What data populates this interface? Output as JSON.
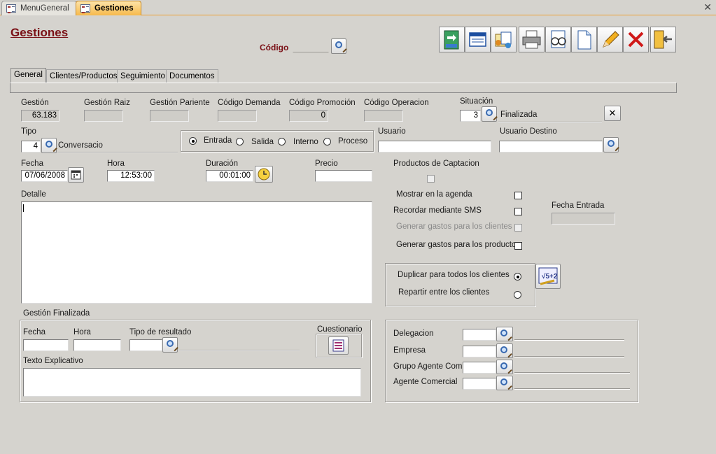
{
  "tabs": {
    "menu_general": "MenuGeneral",
    "gestiones": "Gestiones"
  },
  "header": {
    "title": "Gestiones",
    "codigo_label": "Código",
    "codigo_value": ""
  },
  "toolbar": [
    "door-green-icon",
    "windows-icon",
    "documents-icon",
    "printer-icon",
    "preview-icon",
    "new-doc-icon",
    "pencil-icon",
    "delete-x-icon",
    "exit-door-icon"
  ],
  "page_tabs": [
    "General",
    "Clientes/Productos",
    "Seguimiento",
    "Documentos"
  ],
  "general": {
    "gestion_label": "Gestión",
    "gestion_value": "63.183",
    "gestion_raiz_label": "Gestión Raiz",
    "gestion_raiz_value": "",
    "gestion_pariente_label": "Gestión Pariente",
    "gestion_pariente_value": "",
    "codigo_demanda_label": "Código Demanda",
    "codigo_demanda_value": "",
    "codigo_promocion_label": "Código Promoción",
    "codigo_promocion_value": "0",
    "codigo_operacion_label": "Código Operacion",
    "codigo_operacion_value": "",
    "situacion_label": "Situación",
    "situacion_code": "3",
    "situacion_text": "Finalizada",
    "tipo_label": "Tipo",
    "tipo_code": "4",
    "tipo_text": "Conversacio",
    "radios": [
      "Entrada",
      "Salida",
      "Interno",
      "Proceso"
    ],
    "radio_selected": "Entrada",
    "usuario_label": "Usuario",
    "usuario_value": "",
    "usuario_destino_label": "Usuario Destino",
    "usuario_destino_value": "",
    "fecha_label": "Fecha",
    "fecha_value": "07/06/2008",
    "hora_label": "Hora",
    "hora_value": "12:53:00",
    "duracion_label": "Duración",
    "duracion_value": "00:01:00",
    "precio_label": "Precio",
    "precio_value": "",
    "productos_captacion_label": "Productos de Captacion",
    "detalle_label": "Detalle",
    "mostrar_agenda_label": "Mostrar en la agenda",
    "recordar_sms_label": "Recordar mediante SMS",
    "gastos_clientes_label": "Generar gastos para los clientes",
    "gastos_productos_label": "Generar gastos para los productos",
    "fecha_entrada_label": "Fecha Entrada",
    "duplicar_label": "Duplicar para todos los clientes",
    "repartir_label": "Repartir entre los clientes"
  },
  "finalizada": {
    "group_label": "Gestión Finalizada",
    "fecha_label": "Fecha",
    "hora_label": "Hora",
    "tipo_resultado_label": "Tipo de resultado",
    "cuestionario_label": "Cuestionario",
    "texto_label": "Texto Explicativo"
  },
  "comercial": {
    "delegacion_label": "Delegacion",
    "empresa_label": "Empresa",
    "grupo_agente_label": "Grupo Agente Com.",
    "agente_comercial_label": "Agente Comercial"
  }
}
